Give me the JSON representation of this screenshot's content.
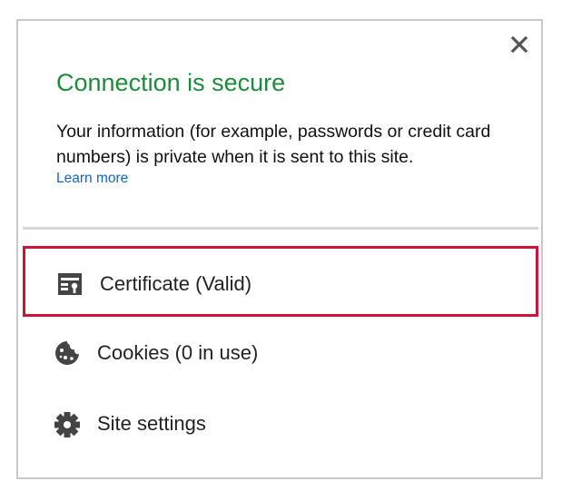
{
  "popup": {
    "title": "Connection is secure",
    "description": "Your information (for example, passwords or credit card numbers) is private when it is sent to this site.",
    "learn_more": "Learn more",
    "close_icon": "close-icon"
  },
  "items": [
    {
      "label": "Certificate (Valid)",
      "icon": "certificate-icon",
      "highlighted": true
    },
    {
      "label": "Cookies (0 in use)",
      "icon": "cookie-icon",
      "highlighted": false
    },
    {
      "label": "Site settings",
      "icon": "gear-icon",
      "highlighted": false
    }
  ],
  "colors": {
    "title": "#1e8a3c",
    "link": "#1565c0",
    "highlight_border": "#cf1236",
    "icon": "#444444"
  }
}
